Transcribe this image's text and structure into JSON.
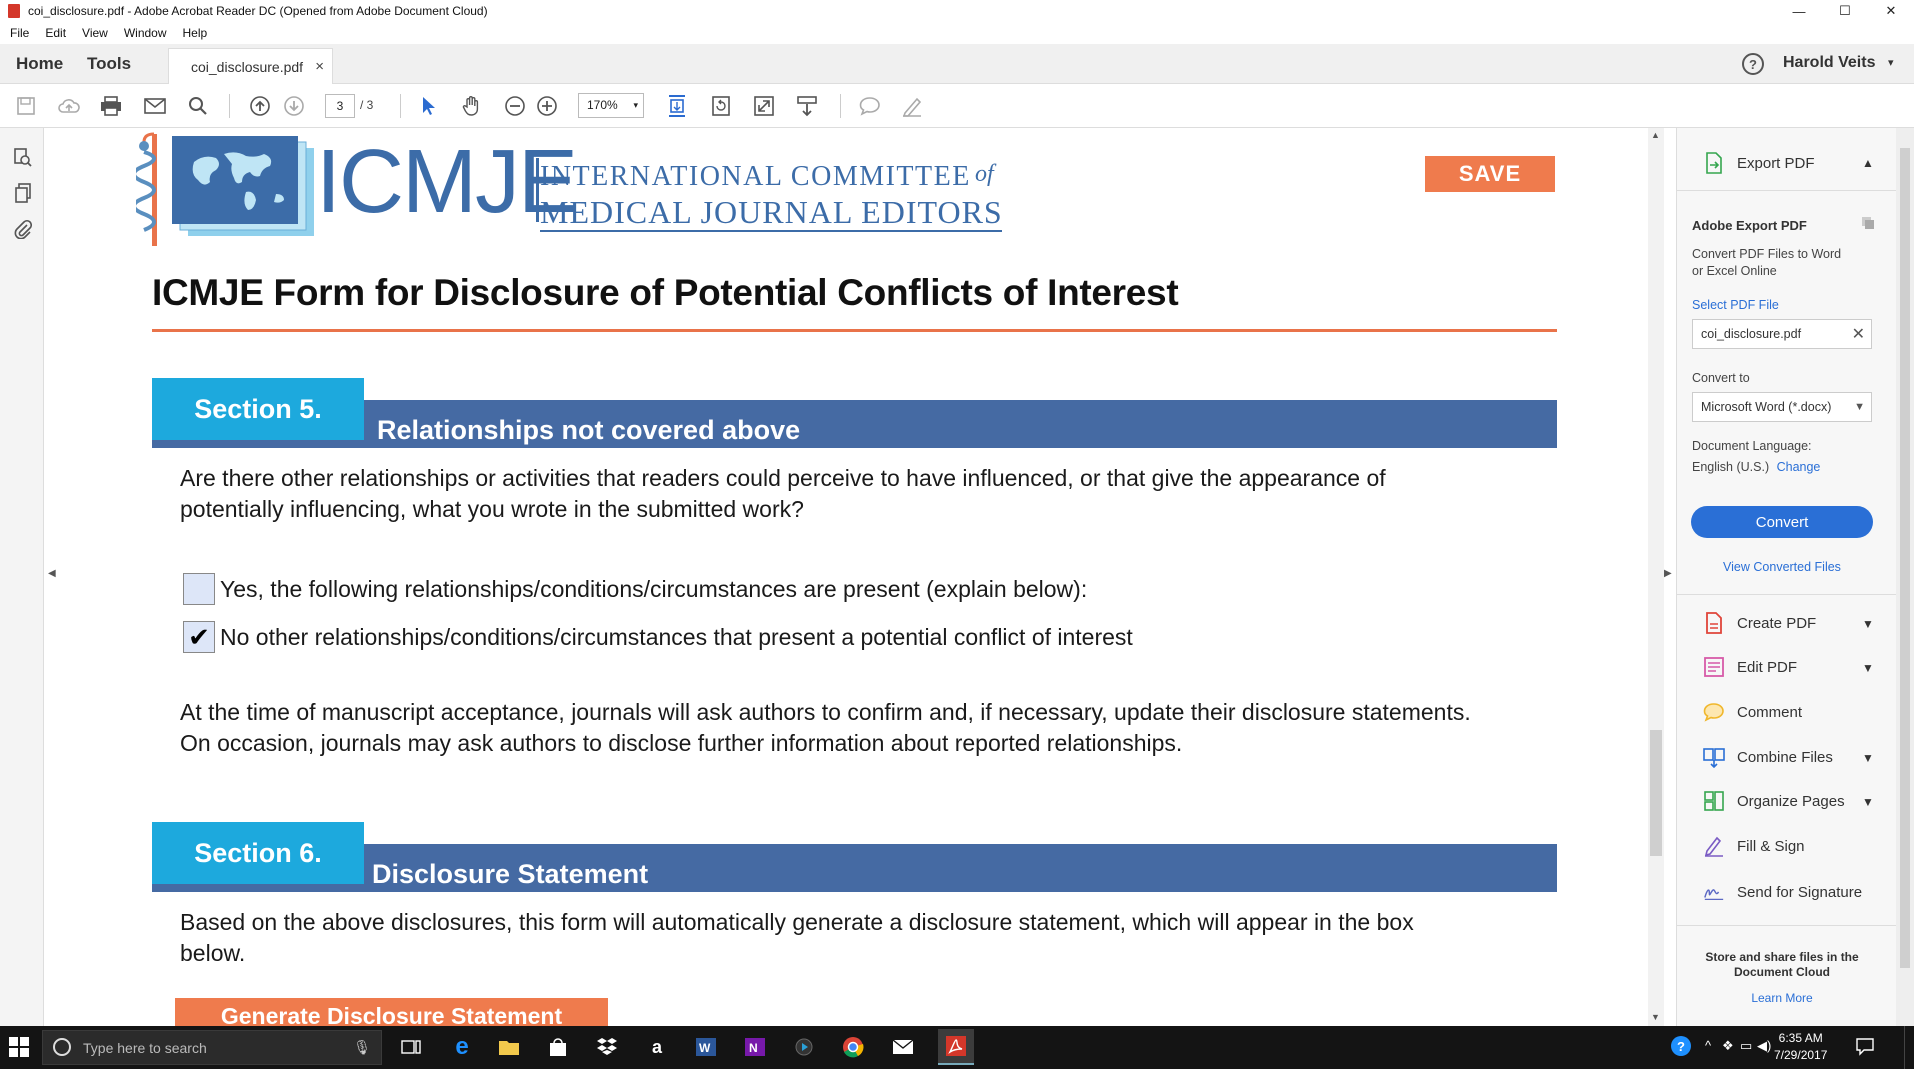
{
  "window": {
    "title": "coi_disclosure.pdf - Adobe Acrobat Reader DC (Opened from Adobe Document Cloud)",
    "minimize": "—",
    "maximize": "☐",
    "close": "✕"
  },
  "menu": [
    "File",
    "Edit",
    "View",
    "Window",
    "Help"
  ],
  "tabs": {
    "home": "Home",
    "tools": "Tools",
    "document": "coi_disclosure.pdf",
    "close": "×",
    "help": "?",
    "user": "Harold Veits",
    "user_caret": "▾"
  },
  "toolbar": {
    "page_current": "3",
    "page_total": "/ 3",
    "zoom": "170%",
    "zoom_caret": "▾"
  },
  "doc": {
    "logo_acronym": "ICMJE",
    "logo_line1": "INTERNATIONAL  COMMITTEE",
    "logo_of": "of",
    "logo_line2": "MEDICAL JOURNAL EDITORS",
    "save": "SAVE",
    "title": "ICMJE Form for Disclosure of Potential Conflicts of Interest",
    "section5": {
      "label": "Section 5.",
      "heading": "Relationships not covered above",
      "question_line1": "Are there other relationships or activities that readers could perceive to have influenced, or that give the appearance of",
      "question_line2": "potentially influencing, what you wrote in the submitted work?",
      "option_yes": "Yes, the following relationships/conditions/circumstances are present (explain below):",
      "option_no": "No other relationships/conditions/circumstances that present a potential conflict of interest",
      "option_no_checked": true,
      "check_mark": "✔",
      "note_line1": "At the time of manuscript acceptance, journals will ask authors to confirm and, if necessary, update their disclosure statements.",
      "note_line2": "On occasion, journals may ask authors to disclose further information about reported relationships."
    },
    "section6": {
      "label": "Section 6.",
      "heading": "Disclosure Statement",
      "text_line1": "Based on the above disclosures, this form will automatically generate a disclosure statement, which will appear in the box",
      "text_line2": "below.",
      "generate_button": "Generate Disclosure Statement"
    }
  },
  "right_panel": {
    "export_header": "Export PDF",
    "export_title": "Adobe Export PDF",
    "export_desc_line1": "Convert PDF Files to Word",
    "export_desc_line2": "or Excel Online",
    "select_file_label": "Select PDF File",
    "selected_file": "coi_disclosure.pdf",
    "convert_to_label": "Convert to",
    "convert_to_value": "Microsoft Word (*.docx)",
    "doc_language_label": "Document Language:",
    "doc_language_value": "English (U.S.)",
    "change_link": "Change",
    "convert_button": "Convert",
    "view_converted": "View Converted Files",
    "tools": [
      {
        "label": "Create PDF",
        "icon": "create-pdf-icon",
        "color": "#e0453a"
      },
      {
        "label": "Edit PDF",
        "icon": "edit-pdf-icon",
        "color": "#d65aa8"
      },
      {
        "label": "Comment",
        "icon": "comment-icon",
        "color": "#f0b72b"
      },
      {
        "label": "Combine Files",
        "icon": "combine-files-icon",
        "color": "#2a6fd6"
      },
      {
        "label": "Organize Pages",
        "icon": "organize-pages-icon",
        "color": "#35a64f"
      },
      {
        "label": "Fill & Sign",
        "icon": "fill-sign-icon",
        "color": "#7b5cc4"
      },
      {
        "label": "Send for Signature",
        "icon": "send-signature-icon",
        "color": "#5c69c4"
      }
    ],
    "store_line1": "Store and share files in the",
    "store_line2": "Document Cloud",
    "learn_more": "Learn More"
  },
  "taskbar": {
    "search_placeholder": "Type here to search",
    "time": "6:35 AM",
    "date": "7/29/2017"
  },
  "colors": {
    "section_box": "#1da9dd",
    "section_band": "#456aa3",
    "accent_orange": "#ef7b4d",
    "acrobat_blue": "#2a6fd6"
  }
}
